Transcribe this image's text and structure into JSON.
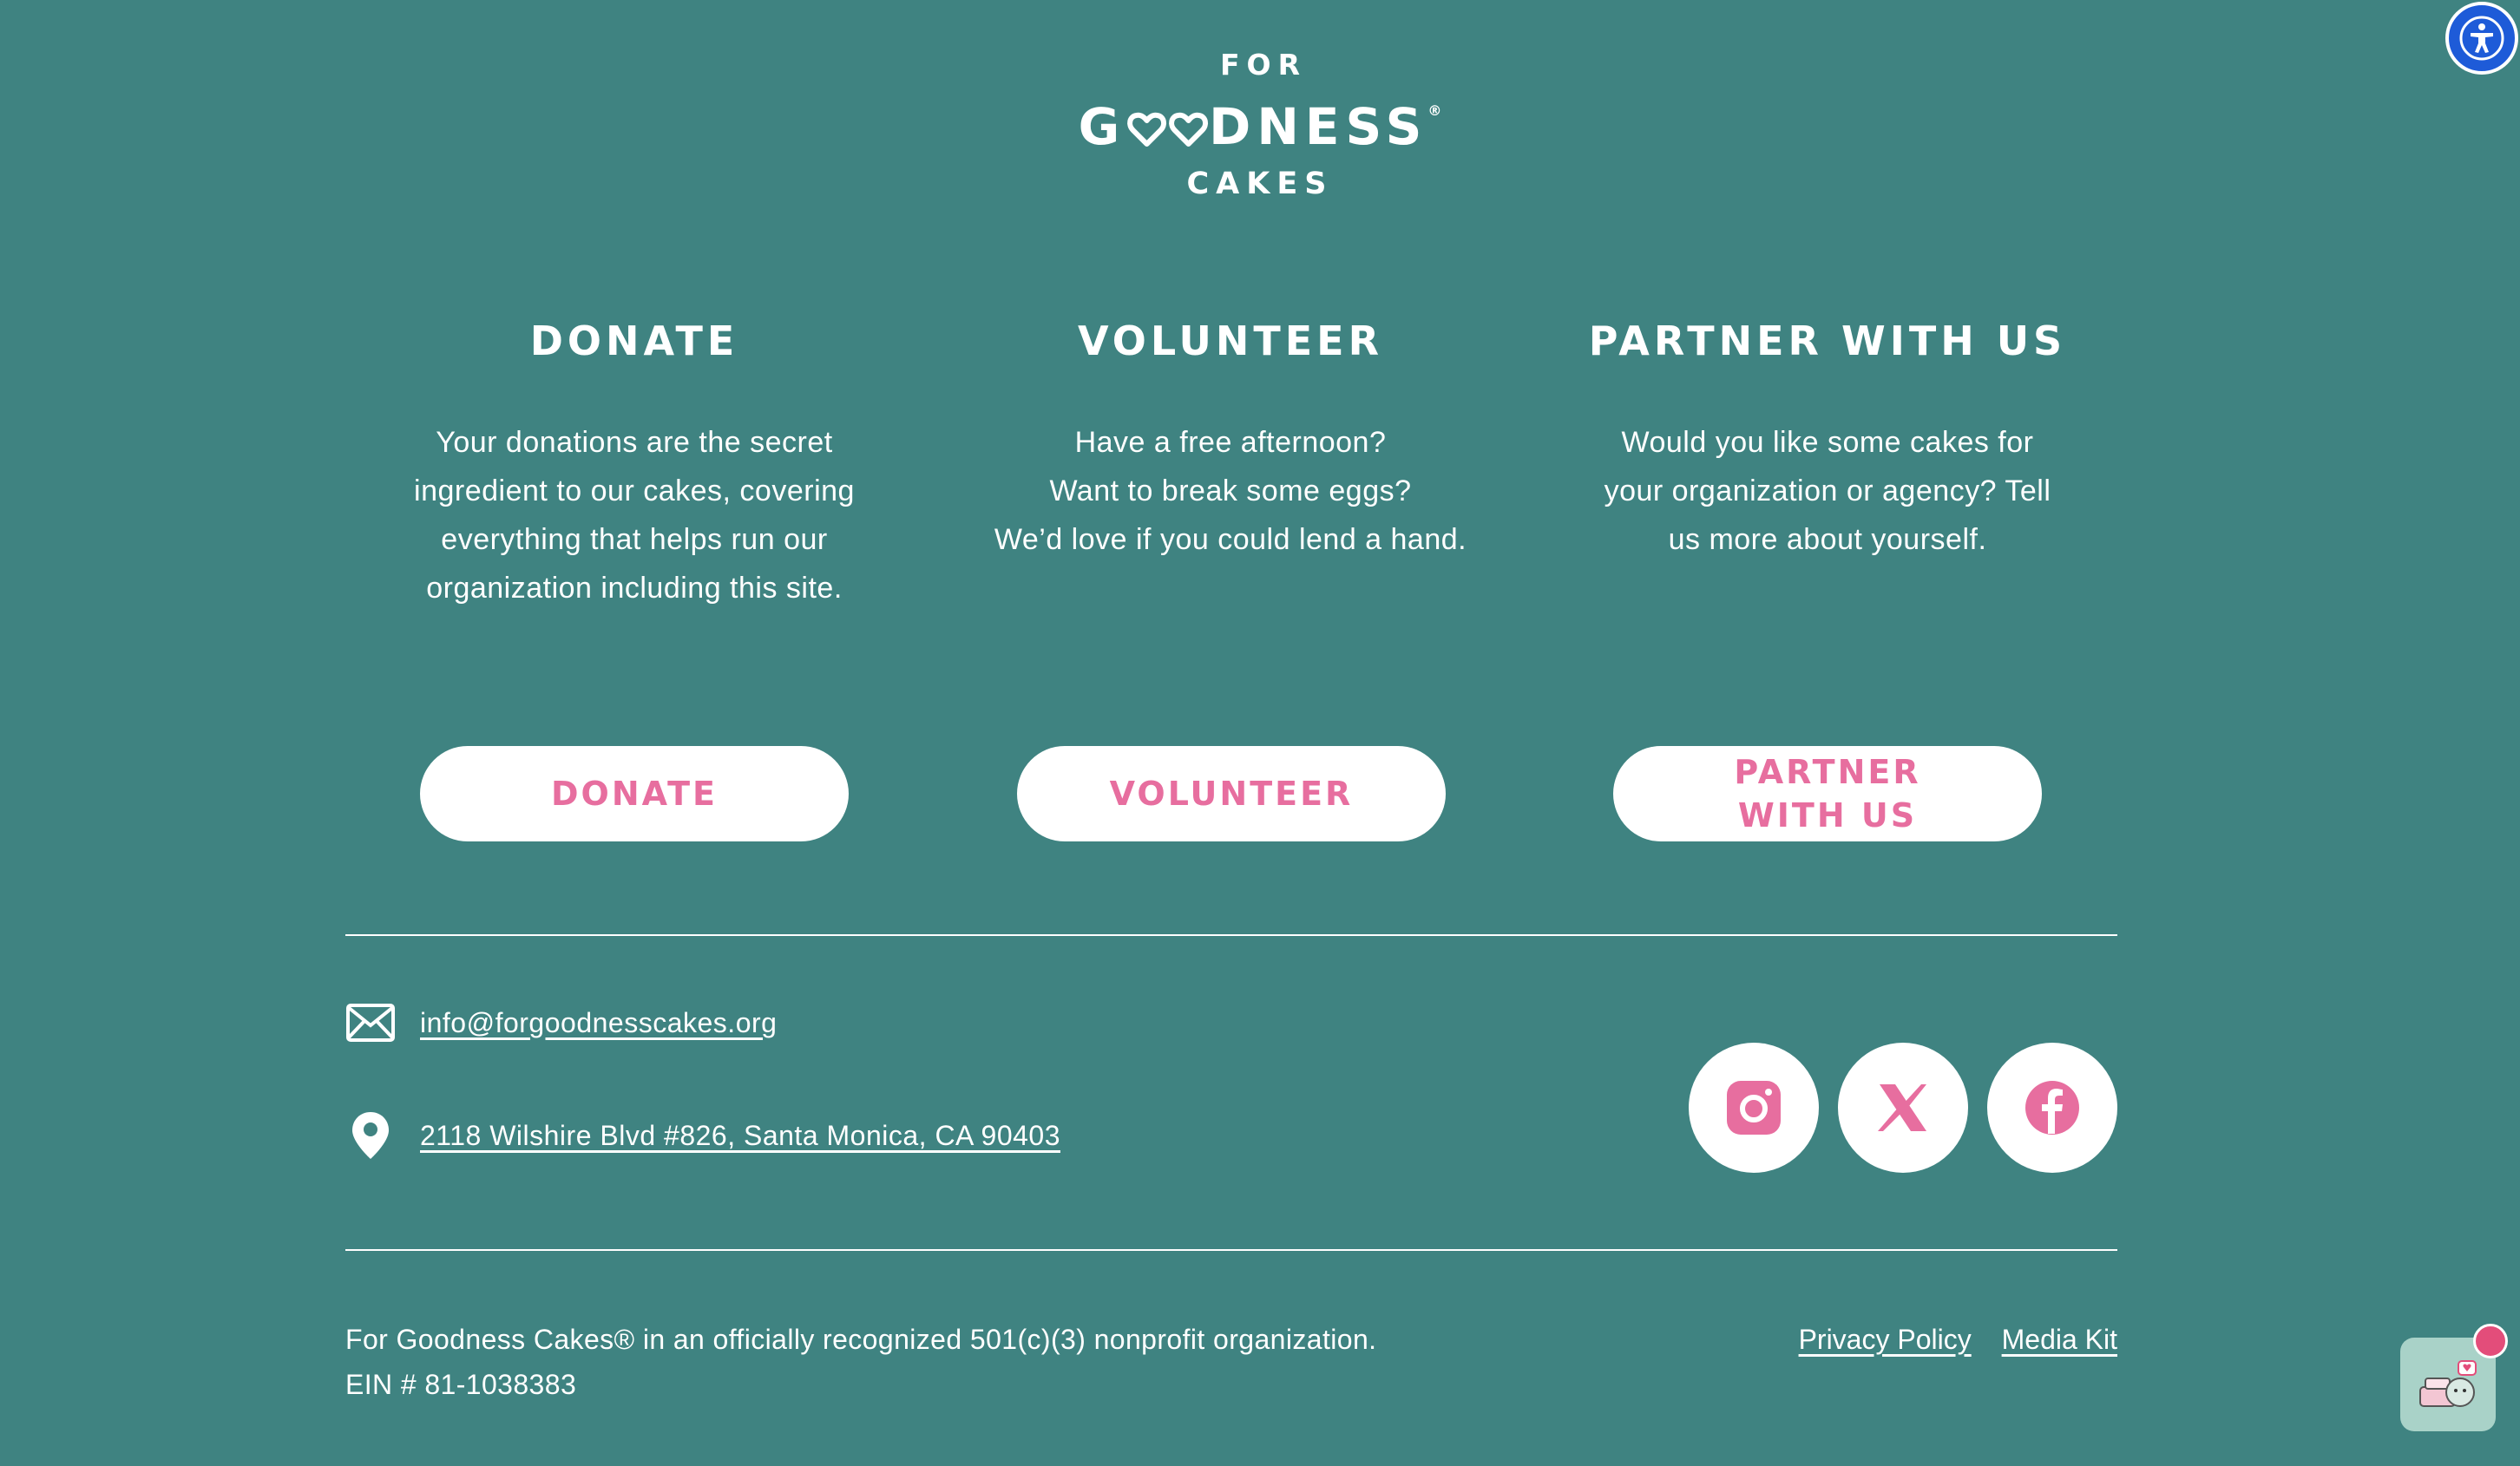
{
  "logo": {
    "line1": "FOR",
    "line2_pre": "G",
    "line2_post": "DNESS",
    "registered": "®",
    "line3": "CAKES"
  },
  "columns": [
    {
      "title": "DONATE",
      "text_lines": [
        "Your donations are the secret",
        "ingredient to our cakes, covering",
        "everything that helps run our",
        "organization including this site."
      ],
      "button": "DONATE"
    },
    {
      "title": "VOLUNTEER",
      "text_lines": [
        "Have a free afternoon?",
        "Want to break some eggs?",
        "We’d love if you could lend a hand."
      ],
      "button": "VOLUNTEER"
    },
    {
      "title": "PARTNER WITH US",
      "text_lines": [
        "Would you like some cakes for",
        "your organization or agency? Tell",
        "us more about yourself."
      ],
      "button_lines": [
        "PARTNER",
        "WITH US"
      ]
    }
  ],
  "contact": {
    "email": "info@forgoodnesscakes.org",
    "address": "2118 Wilshire Blvd #826, Santa Monica, CA 90403"
  },
  "social": [
    "instagram-icon",
    "x-icon",
    "facebook-icon"
  ],
  "legal": {
    "line1": "For Goodness Cakes® in an officially recognized 501(c)(3) nonprofit organization.",
    "line2": "EIN # 81-1038383"
  },
  "links": {
    "privacy": "Privacy Policy",
    "media_kit": "Media Kit"
  },
  "colors": {
    "background": "#3f8381",
    "accent_pink": "#e76e9f",
    "a11y_blue": "#1e5bd8",
    "white": "#ffffff"
  }
}
